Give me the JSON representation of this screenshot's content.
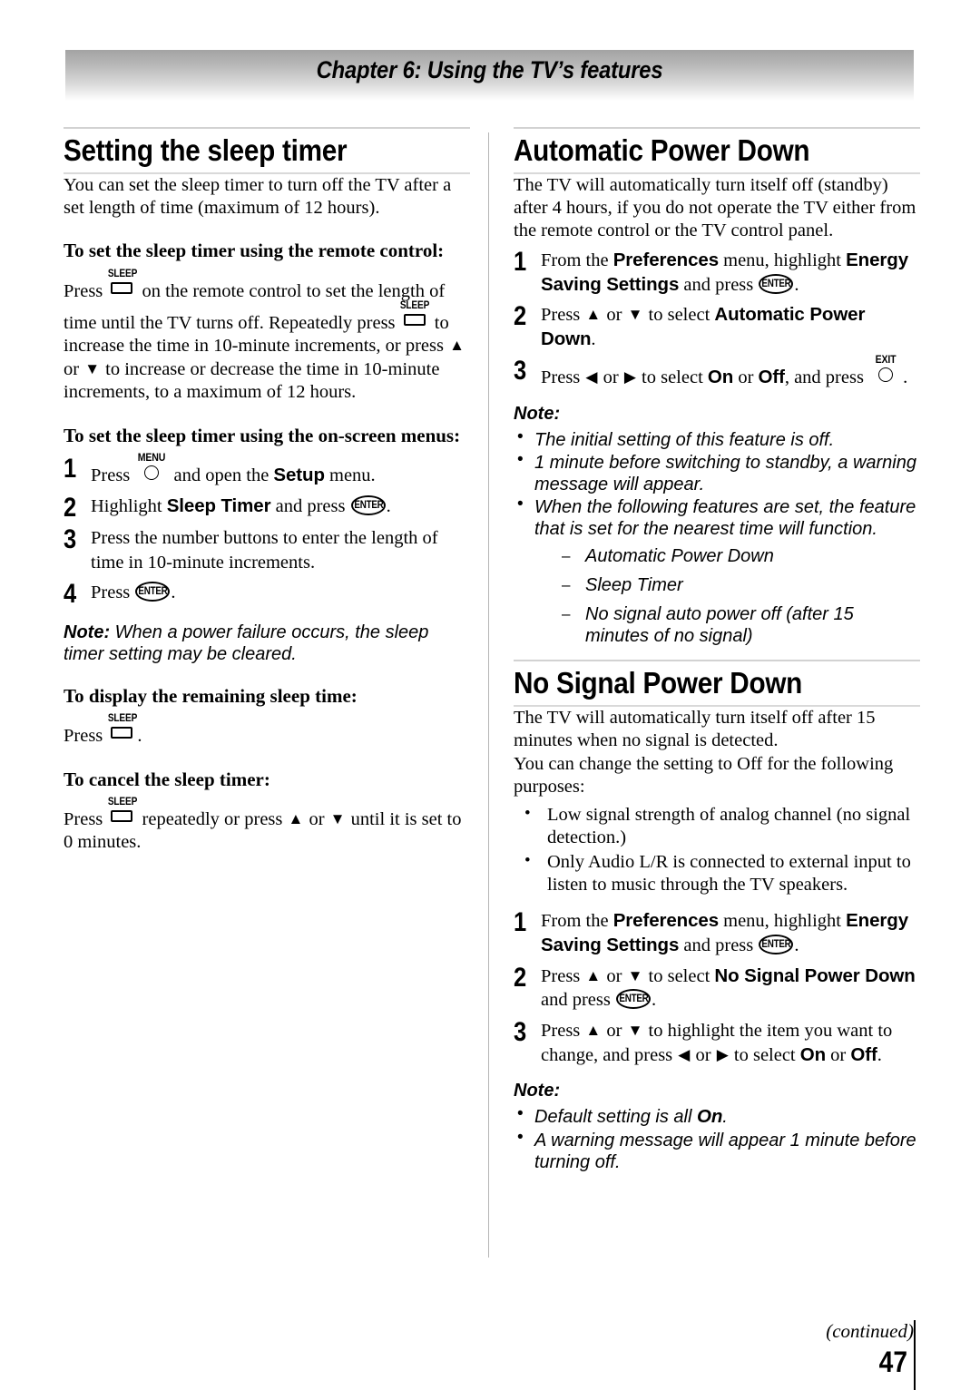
{
  "header": {
    "chapter_title": "Chapter 6: Using the TV’s features"
  },
  "footer": {
    "continued": "(continued)",
    "page_number": "47"
  },
  "keys": {
    "sleep": "SLEEP",
    "menu": "MENU",
    "enter": "ENTER",
    "exit": "EXIT",
    "up_arrow": "▲",
    "down_arrow": "▼",
    "left_arrow": "◀",
    "right_arrow": "▶"
  },
  "left_column": {
    "section_title": "Setting the sleep timer",
    "intro": "You can set the sleep timer to turn off the TV after a set length of time (maximum of 12 hours).",
    "sub1": {
      "heading": "To set the sleep timer using the remote control:",
      "t1": "Press ",
      "t2": " on the remote control to set the length of time until the TV turns off. Repeatedly press ",
      "t3": " to increase the time in 10-minute increments, or press ",
      "t4": " or ",
      "t5": " to increase or decrease the time in 10-minute increments, to a maximum of 12 hours."
    },
    "sub2": {
      "heading": "To set the sleep timer using the on-screen menus:",
      "steps": [
        {
          "num": "1",
          "t1": "Press ",
          "t2": " and open the ",
          "bold1": "Setup",
          "t3": " menu."
        },
        {
          "num": "2",
          "t1": "Highlight ",
          "bold1": "Sleep Timer",
          "t2": " and press ",
          "t3": "."
        },
        {
          "num": "3",
          "t1": "Press the number buttons to enter the length of time in 10-minute increments."
        },
        {
          "num": "4",
          "t1": "Press ",
          "t2": "."
        }
      ],
      "note_label": "Note:",
      "note_text": " When a power failure occurs, the sleep timer setting may be cleared."
    },
    "sub3": {
      "heading": "To display the remaining sleep time:",
      "t1": "Press ",
      "t2": "."
    },
    "sub4": {
      "heading": "To cancel the sleep timer:",
      "t1": "Press ",
      "t2": " repeatedly or press ",
      "t3": " or ",
      "t4": " until it is set to 0 minutes."
    }
  },
  "right_column": {
    "section1": {
      "title": "Automatic Power Down",
      "intro": "The TV will automatically turn itself off (standby) after 4 hours, if you do not operate the TV either from the remote control or the TV control panel.",
      "steps": [
        {
          "num": "1",
          "t1": "From the ",
          "bold1": "Preferences",
          "t2": " menu, highlight ",
          "bold2": "Energy Saving Settings",
          "t3": " and press ",
          "t4": "."
        },
        {
          "num": "2",
          "t1": "Press ",
          "t2": " or ",
          "t3": " to select ",
          "bold1": "Automatic Power Down",
          "t4": "."
        },
        {
          "num": "3",
          "t1": "Press ",
          "t2": " or ",
          "t3": " to select ",
          "bold1": "On",
          "t4": " or ",
          "bold2": "Off",
          "t5": ", and press ",
          "t6": "."
        }
      ],
      "note_label": "Note:",
      "note_items": [
        "The initial setting of this feature is off.",
        "1 minute before switching to standby, a warning message will appear.",
        "When the following features are set, the feature that is set for the nearest time will function."
      ],
      "note_sub_items": [
        "Automatic Power Down",
        "Sleep Timer",
        "No signal auto power off (after 15 minutes of no signal)"
      ]
    },
    "section2": {
      "title": "No Signal Power Down",
      "intro_line1": "The TV will automatically turn itself off after 15 minutes when no signal is detected.",
      "intro_line2": "You can change the setting to Off for the following purposes:",
      "bullets": [
        "Low signal strength of analog channel (no signal detection.)",
        "Only Audio L/R is connected to external input to listen to music through the TV speakers."
      ],
      "steps": [
        {
          "num": "1",
          "t1": "From the ",
          "bold1": "Preferences",
          "t2": " menu, highlight ",
          "bold2": "Energy Saving Settings",
          "t3": " and press ",
          "t4": "."
        },
        {
          "num": "2",
          "t1": "Press ",
          "t2": " or ",
          "t3": " to select ",
          "bold1": "No Signal Power Down",
          "t4": " and press ",
          "t5": "."
        },
        {
          "num": "3",
          "t1": "Press ",
          "t2": " or ",
          "t3": " to highlight the item you want to change, and press ",
          "t4": " or ",
          "t5": " to select ",
          "bold1": "On",
          "t6": " or ",
          "bold2": "Off",
          "t7": "."
        }
      ],
      "note_label": "Note:",
      "note_items_pre": [
        "Default setting is all ",
        "A warning message will appear 1 minute before turning off."
      ],
      "note_bold_on": "On",
      "note_item1_post": "."
    }
  }
}
